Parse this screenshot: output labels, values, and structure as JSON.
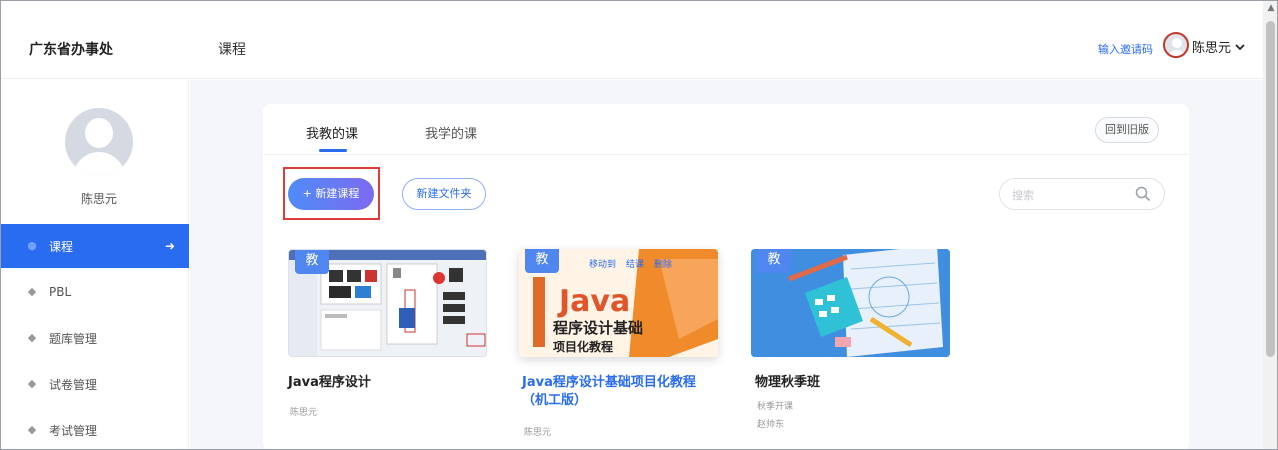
{
  "header": {
    "org_name": "广东省办事处",
    "breadcrumb": "课程",
    "invite_link": "输入邀请码",
    "user_name": "陈思元"
  },
  "sidebar": {
    "user_name": "陈思元",
    "items": [
      {
        "label": "课程",
        "icon": "book-icon",
        "active": true
      },
      {
        "label": "PBL",
        "icon": "graduation-cap-icon",
        "active": false
      },
      {
        "label": "题库管理",
        "icon": "graduation-cap-icon",
        "active": false
      },
      {
        "label": "试卷管理",
        "icon": "graduation-cap-icon",
        "active": false
      },
      {
        "label": "考试管理",
        "icon": "graduation-cap-icon",
        "active": false
      }
    ]
  },
  "tabs": [
    {
      "label": "我教的课",
      "active": true
    },
    {
      "label": "我学的课",
      "active": false
    }
  ],
  "toolbar": {
    "old_version": "回到旧版",
    "new_course": "+ 新建课程",
    "new_folder": "新建文件夹",
    "search_placeholder": "搜索"
  },
  "courses": [
    {
      "badge": "教",
      "title": "Java程序设计",
      "line1": "陈思元",
      "line2": ""
    },
    {
      "badge": "教",
      "title": "Java程序设计基础项目化教程",
      "title2": "（机工版）",
      "line1": "陈思元",
      "line2": "",
      "actions": [
        "移动到",
        "结课",
        "删除"
      ],
      "cover_big": "Java",
      "cover_line1": "程序设计基础",
      "cover_line2": "项目化教程"
    },
    {
      "badge": "教",
      "title": "物理秋季班",
      "line1": "秋季开课",
      "line2": "赵帅东"
    }
  ],
  "colors": {
    "accent": "#2a6cf0",
    "highlight": "#e23b3b"
  }
}
